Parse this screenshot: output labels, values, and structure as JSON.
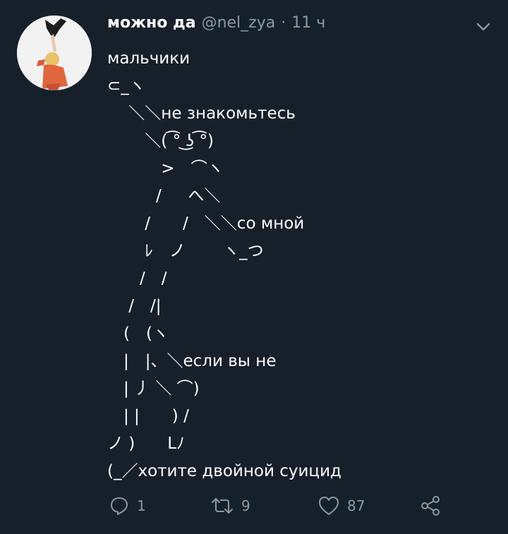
{
  "tweet": {
    "display_name": "можно да",
    "handle": "@nel_zya",
    "separator": "·",
    "time": "11 ч",
    "text": "мальчики\n⊂_ヽ\n　 ＼＼не знакомьтесь\n　　 ＼( ͡° ͜ʖ ͡°)\n　　　 >　⌒ヽ\n　　　/ 　 へ＼\n　　 /　　/　＼＼со мной\n　　 ﾚ　ノ　　 ヽ_つ\n　　/　/\n　 /　/|\n　(　(ヽ\n　|　|、＼если вы не\n　| 丿 ＼ ⌒)\n　| |　　) /\nノ )　　Lﾉ\n(_／хотите двойной суицид"
  },
  "actions": {
    "reply": {
      "icon": "reply-icon",
      "count": "1"
    },
    "retweet": {
      "icon": "retweet-icon",
      "count": "9"
    },
    "like": {
      "icon": "heart-icon",
      "count": "87"
    },
    "share": {
      "icon": "share-icon"
    }
  },
  "colors": {
    "background": "#15202b",
    "text": "#ffffff",
    "muted": "#8899a6"
  }
}
